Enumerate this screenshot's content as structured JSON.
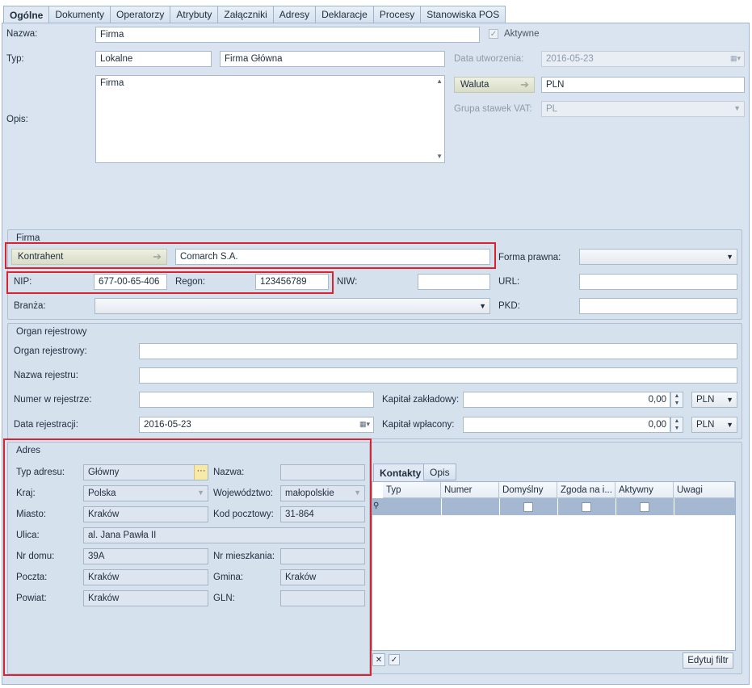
{
  "tabs": [
    "Ogólne",
    "Dokumenty",
    "Operatorzy",
    "Atrybuty",
    "Załączniki",
    "Adresy",
    "Deklaracje",
    "Procesy",
    "Stanowiska POS"
  ],
  "general": {
    "nazwa_label": "Nazwa:",
    "nazwa_value": "Firma",
    "aktywne_label": "Aktywne",
    "typ_label": "Typ:",
    "typ_value": "Lokalne",
    "typ_company": "Firma Główna",
    "data_utworzenia_label": "Data utworzenia:",
    "data_utworzenia_value": "2016-05-23",
    "opis_label": "Opis:",
    "opis_value": "Firma",
    "waluta_label": "Waluta",
    "waluta_value": "PLN",
    "grupa_vat_label": "Grupa stawek VAT:",
    "grupa_vat_value": "PL"
  },
  "firma": {
    "title": "Firma",
    "kontrahent_label": "Kontrahent",
    "kontrahent_value": "Comarch S.A.",
    "forma_prawna_label": "Forma prawna:",
    "nip_label": "NIP:",
    "nip_value": "677-00-65-406",
    "regon_label": "Regon:",
    "regon_value": "123456789",
    "niw_label": "NIW:",
    "url_label": "URL:",
    "branza_label": "Branża:",
    "pkd_label": "PKD:"
  },
  "organ": {
    "title": "Organ rejestrowy",
    "organ_label": "Organ rejestrowy:",
    "nazwa_rejestru_label": "Nazwa rejestru:",
    "numer_label": "Numer w rejestrze:",
    "data_rej_label": "Data rejestracji:",
    "data_rej_value": "2016-05-23",
    "kapital_zakl_label": "Kapitał zakładowy:",
    "kapital_zakl_value": "0,00",
    "kapital_zakl_cur": "PLN",
    "kapital_wpl_label": "Kapitał wpłacony:",
    "kapital_wpl_value": "0,00",
    "kapital_wpl_cur": "PLN"
  },
  "adres": {
    "title": "Adres",
    "typ_adresu_label": "Typ adresu:",
    "typ_adresu_value": "Główny",
    "nazwa_label": "Nazwa:",
    "kraj_label": "Kraj:",
    "kraj_value": "Polska",
    "woj_label": "Województwo:",
    "woj_value": "małopolskie",
    "miasto_label": "Miasto:",
    "miasto_value": "Kraków",
    "kod_label": "Kod pocztowy:",
    "kod_value": "31-864",
    "ulica_label": "Ulica:",
    "ulica_value": "al. Jana Pawła II",
    "nr_domu_label": "Nr domu:",
    "nr_domu_value": "39A",
    "nr_mieszk_label": "Nr mieszkania:",
    "poczta_label": "Poczta:",
    "poczta_value": "Kraków",
    "gmina_label": "Gmina:",
    "gmina_value": "Kraków",
    "powiat_label": "Powiat:",
    "powiat_value": "Kraków",
    "gln_label": "GLN:"
  },
  "contacts": {
    "tabs": [
      "Kontakty",
      "Opis"
    ],
    "columns": [
      "Typ",
      "Numer",
      "Domyślny",
      "Zgoda na i...",
      "Aktywny",
      "Uwagi"
    ],
    "edit_filter": "Edytuj filtr"
  }
}
